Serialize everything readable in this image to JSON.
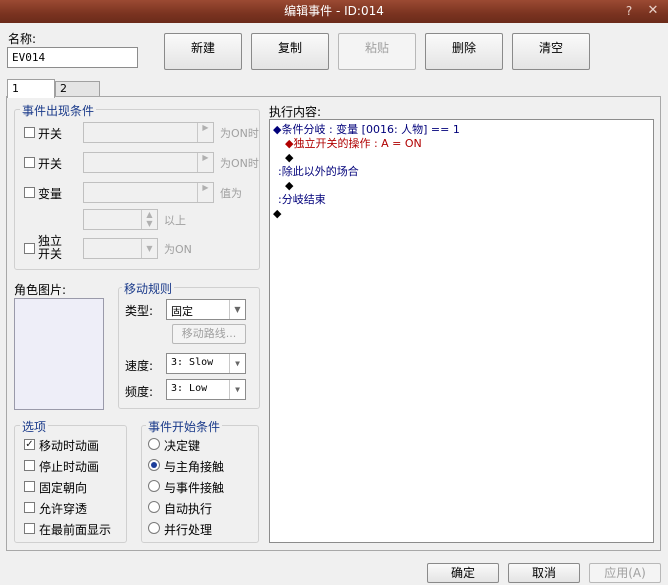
{
  "window": {
    "title": "编辑事件 - ID:014",
    "help": "?",
    "close": "✕"
  },
  "name_field": {
    "label": "名称:",
    "value": "EV014"
  },
  "toolbar": {
    "new": "新建",
    "copy": "复制",
    "paste": "粘贴",
    "delete": "删除",
    "clear": "清空"
  },
  "tabs": [
    "1",
    "2"
  ],
  "conditions": {
    "title": "事件出现条件",
    "switch1": {
      "label": "开关",
      "suffix": "为ON时"
    },
    "switch2": {
      "label": "开关",
      "suffix": "为ON时"
    },
    "variable": {
      "label": "变量",
      "suffix": "值为",
      "suffix2": "以上"
    },
    "self_switch": {
      "label_line1": "独立",
      "label_line2": "开关",
      "suffix": "为ON"
    }
  },
  "graphic": {
    "label": "角色图片:"
  },
  "movement": {
    "title": "移动规则",
    "type_label": "类型:",
    "type_value": "固定",
    "route_button": "移动路线...",
    "speed_label": "速度:",
    "speed_value": "3: Slow",
    "freq_label": "频度:",
    "freq_value": "3: Low"
  },
  "options": {
    "title": "选项",
    "items": [
      {
        "label": "移动时动画",
        "checked": true
      },
      {
        "label": "停止时动画",
        "checked": false
      },
      {
        "label": "固定朝向",
        "checked": false
      },
      {
        "label": "允许穿透",
        "checked": false
      },
      {
        "label": "在最前面显示",
        "checked": false
      }
    ]
  },
  "trigger": {
    "title": "事件开始条件",
    "items": [
      {
        "label": "决定键",
        "selected": false
      },
      {
        "label": "与主角接触",
        "selected": true
      },
      {
        "label": "与事件接触",
        "selected": false
      },
      {
        "label": "自动执行",
        "selected": false
      },
      {
        "label": "并行处理",
        "selected": false
      }
    ]
  },
  "contents": {
    "label": "执行内容:",
    "lines": [
      "◆条件分岐 : 变量 [0016: 人物] == 1",
      "◆独立开关的操作 : A = ON",
      "◆",
      ":除此以外的场合",
      "◆",
      ":分岐结束",
      "◆"
    ],
    "colors": {
      "branch": "#00007a",
      "self_switch": "#b00000"
    }
  },
  "footer": {
    "ok": "确定",
    "cancel": "取消",
    "apply": "应用(A)"
  }
}
